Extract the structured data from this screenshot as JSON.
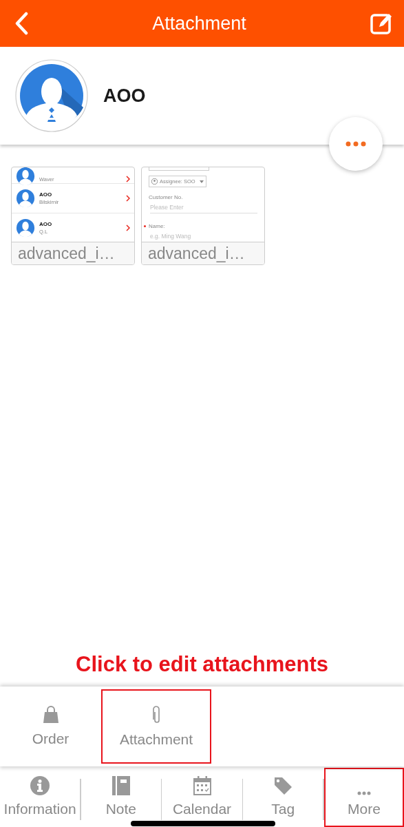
{
  "header": {
    "title": "Attachment"
  },
  "profile": {
    "name": "AOO"
  },
  "attachments": [
    {
      "kind": "contact-list",
      "caption": "advanced_i…",
      "rows": [
        {
          "subtitle": "Waver"
        },
        {
          "name": "AOO",
          "subtitle": "Bilskirnir"
        },
        {
          "name": "AOO",
          "subtitle": "Q.L"
        }
      ]
    },
    {
      "kind": "form",
      "caption": "advanced_i…",
      "assignee": "Assignee: SOO",
      "field_label": "Customer No.",
      "field_placeholder": "Please Enter",
      "name_label": "Name:",
      "name_placeholder": "e.g. Ming Wang"
    }
  ],
  "annotation": "Click to edit attachments",
  "sheet_items": [
    {
      "label": "Order",
      "kind": "bag",
      "highlighted": false
    },
    {
      "label": "Attachment",
      "kind": "clip",
      "highlighted": true
    }
  ],
  "tab_bar": [
    {
      "label": "Information",
      "kind": "info",
      "highlighted": false
    },
    {
      "label": "Note",
      "kind": "note",
      "highlighted": false
    },
    {
      "label": "Calendar",
      "kind": "calendar",
      "highlighted": false
    },
    {
      "label": "Tag",
      "kind": "tag",
      "highlighted": false
    },
    {
      "label": "More",
      "kind": "more",
      "highlighted": true
    }
  ]
}
